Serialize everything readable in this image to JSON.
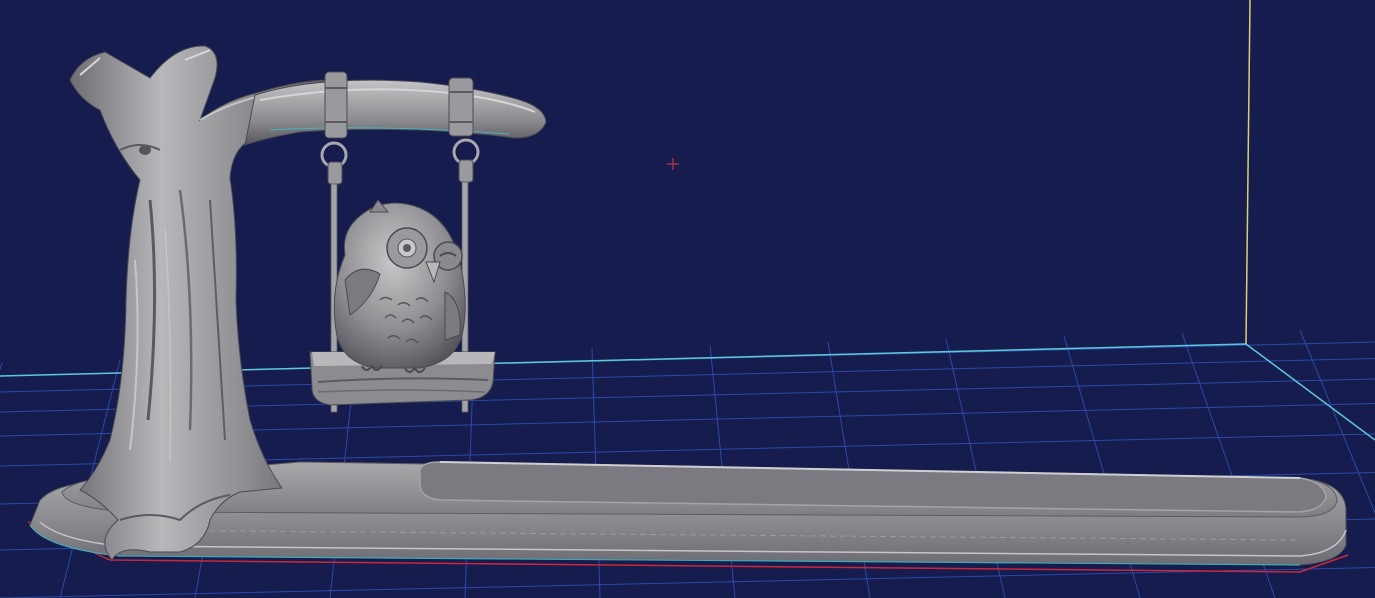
{
  "viewport": {
    "kind": "3d-slicer-preview",
    "background_color": "#161d4e",
    "grid_color": "#2a4aa8",
    "build_volume_edge_color": "#5ec8d8",
    "vertical_axis_color": "#d8d070",
    "bed_outline_color": "#c8283a",
    "cursor_color": "#e03a3a",
    "model_color": "#8e8e8e",
    "model_highlight_color": "#c4c4c4",
    "model_shadow_color": "#4a4a52"
  },
  "scene": {
    "objects": [
      {
        "kind": "tree-trunk",
        "label": ""
      },
      {
        "kind": "branch",
        "label": ""
      },
      {
        "kind": "swing",
        "label": ""
      },
      {
        "kind": "owl-figurine",
        "label": ""
      },
      {
        "kind": "incense-tray-base",
        "label": ""
      }
    ]
  }
}
